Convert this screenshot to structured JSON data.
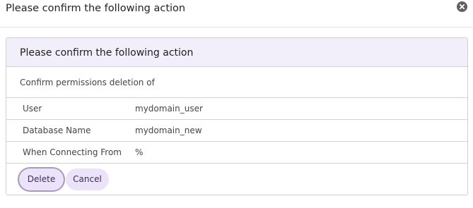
{
  "dialog": {
    "title": "Please confirm the following action"
  },
  "panel": {
    "heading": "Please confirm the following action",
    "description": "Confirm permissions deletion of",
    "details": [
      {
        "label": "User",
        "value": "mydomain_user"
      },
      {
        "label": "Database Name",
        "value": "mydomain_new"
      },
      {
        "label": "When Connecting From",
        "value": "%"
      }
    ]
  },
  "actions": {
    "delete_label": "Delete",
    "cancel_label": "Cancel"
  },
  "colors": {
    "panel_heading_bg": "#f3effa",
    "button_bg": "#ece3fb",
    "close_icon_bg": "#5f5f5f"
  },
  "icons": {
    "close": "close-icon"
  }
}
